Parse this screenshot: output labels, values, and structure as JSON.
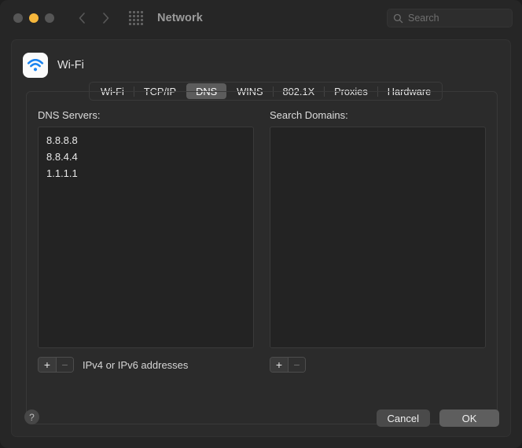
{
  "window": {
    "title": "Network",
    "traffic_lights": [
      {
        "name": "close",
        "color": "#565656"
      },
      {
        "name": "minimize",
        "color": "#f6b73c"
      },
      {
        "name": "zoom",
        "color": "#565656"
      }
    ],
    "nav": {
      "back_icon": "chevron-left-icon",
      "forward_icon": "chevron-right-icon",
      "show_all_icon": "grid-dots-icon"
    },
    "search": {
      "placeholder": "Search",
      "value": "",
      "icon": "search-icon"
    }
  },
  "sheet": {
    "service": {
      "name": "Wi-Fi",
      "icon": "wifi-icon"
    },
    "tabs": [
      {
        "label": "Wi-Fi",
        "selected": false
      },
      {
        "label": "TCP/IP",
        "selected": false
      },
      {
        "label": "DNS",
        "selected": true
      },
      {
        "label": "WINS",
        "selected": false
      },
      {
        "label": "802.1X",
        "selected": false
      },
      {
        "label": "Proxies",
        "selected": false
      },
      {
        "label": "Hardware",
        "selected": false
      }
    ],
    "dns": {
      "label": "DNS Servers:",
      "entries": [
        "8.8.8.8",
        "8.8.4.4",
        "1.1.1.1"
      ],
      "add_label": "+",
      "remove_label": "−",
      "hint": "IPv4 or IPv6 addresses"
    },
    "search_domains": {
      "label": "Search Domains:",
      "entries": [],
      "add_label": "+",
      "remove_label": "−"
    },
    "help_label": "?",
    "cancel_label": "Cancel",
    "ok_label": "OK",
    "accent": "#5e5e5e"
  }
}
